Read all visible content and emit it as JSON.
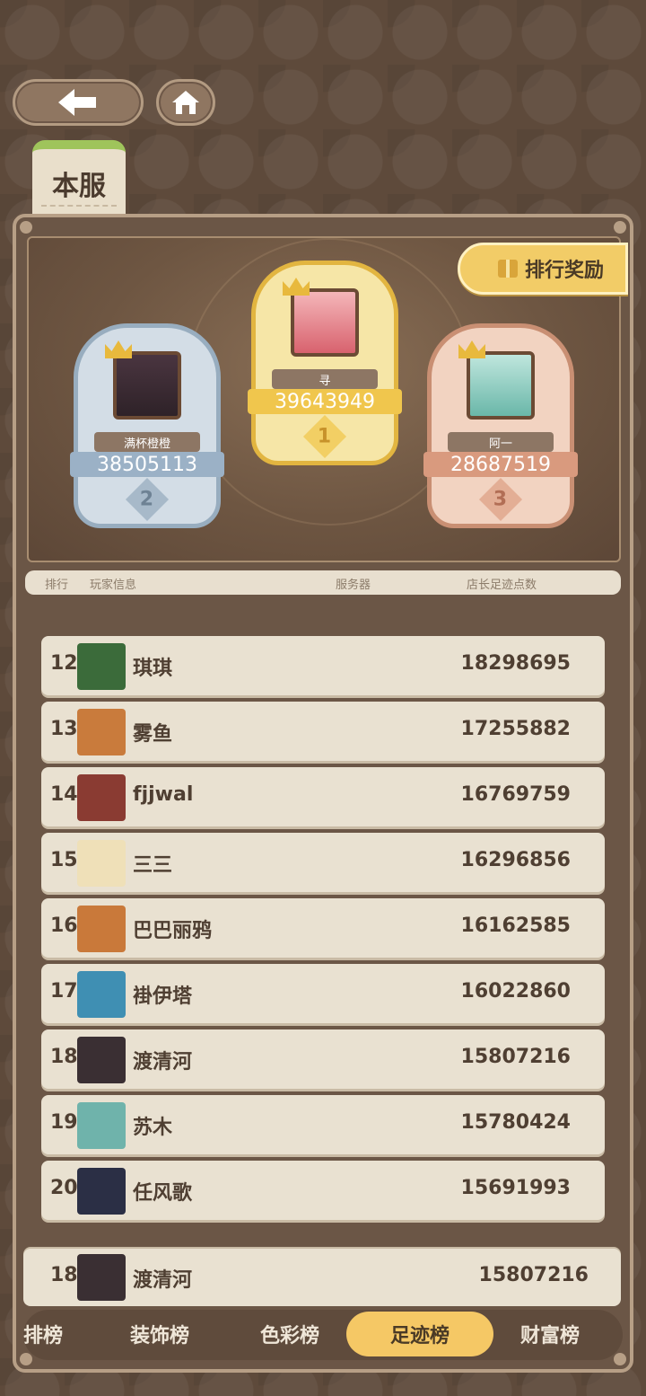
{
  "nav": {
    "back_icon": "arrow-left-icon",
    "home_icon": "home-icon"
  },
  "server_tab": {
    "label": "本服"
  },
  "reward_button": {
    "label": "排行奖励",
    "icon": "gift-icon"
  },
  "podium": {
    "first": {
      "rank": "1",
      "name": "寻",
      "score": "39643949"
    },
    "second": {
      "rank": "2",
      "name": "满杯橙橙",
      "score": "38505113"
    },
    "third": {
      "rank": "3",
      "name": "阿一",
      "score": "28687519"
    }
  },
  "header": {
    "rank": "排行",
    "player": "玩家信息",
    "server": "服务器",
    "score": "店长足迹点数"
  },
  "rows": [
    {
      "rank": "12",
      "name": "琪琪",
      "score": "18298695",
      "color": "#3b6b3a"
    },
    {
      "rank": "13",
      "name": "雾鱼",
      "score": "17255882",
      "color": "#c97b3c"
    },
    {
      "rank": "14",
      "name": "fjjwal",
      "score": "16769759",
      "color": "#8a3b32"
    },
    {
      "rank": "15",
      "name": "三三",
      "score": "16296856",
      "color": "#efe0b8"
    },
    {
      "rank": "16",
      "name": "巴巴丽鸦",
      "score": "16162585",
      "color": "#c9793a"
    },
    {
      "rank": "17",
      "name": "褂伊塔",
      "score": "16022860",
      "color": "#3f8fb3"
    },
    {
      "rank": "18",
      "name": "渡清河",
      "score": "15807216",
      "color": "#3a2f33"
    },
    {
      "rank": "19",
      "name": "苏木",
      "score": "15780424",
      "color": "#6fb3ab"
    },
    {
      "rank": "20",
      "name": "任风歌",
      "score": "15691993",
      "color": "#2b2f45"
    }
  ],
  "self": {
    "rank": "18",
    "name": "渡清河",
    "score": "15807216"
  },
  "tabs": [
    {
      "label": "排榜"
    },
    {
      "label": "装饰榜"
    },
    {
      "label": "色彩榜"
    },
    {
      "label": "足迹榜",
      "active": true
    },
    {
      "label": "财富榜"
    }
  ]
}
